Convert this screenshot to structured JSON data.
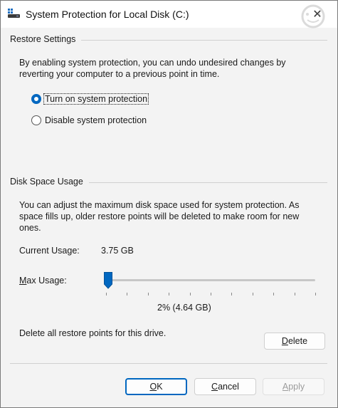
{
  "window": {
    "title": "System Protection for Local Disk (C:)",
    "close_glyph": "✕"
  },
  "restore_settings": {
    "group_label": "Restore Settings",
    "description_line1": "By enabling system protection, you can undo undesired changes by",
    "description_line2": "reverting your computer to a previous point in time.",
    "options": [
      {
        "label": "Turn on system protection",
        "selected": true
      },
      {
        "label": "Disable system protection",
        "selected": false
      }
    ]
  },
  "disk_space": {
    "group_label": "Disk Space Usage",
    "description_line1": "You can adjust the maximum disk space used for system protection. As",
    "description_line2": "space fills up, older restore points will be deleted to make room for new",
    "description_line3": "ones.",
    "current_usage_label": "Current Usage:",
    "current_usage_value": "3.75 GB",
    "max_usage_label_first": "M",
    "max_usage_label_rest": "ax Usage:",
    "max_usage_percent": 2,
    "max_usage_display": "2% (4.64 GB)",
    "delete_description": "Delete all restore points for this drive.",
    "delete_button_first": "D",
    "delete_button_rest": "elete"
  },
  "buttons": {
    "ok_first": "O",
    "ok_rest": "K",
    "cancel_first": "C",
    "cancel_rest": "ancel",
    "apply_first": "A",
    "apply_rest": "pply"
  },
  "colors": {
    "accent": "#0067c0",
    "background": "#f3f3f3"
  }
}
